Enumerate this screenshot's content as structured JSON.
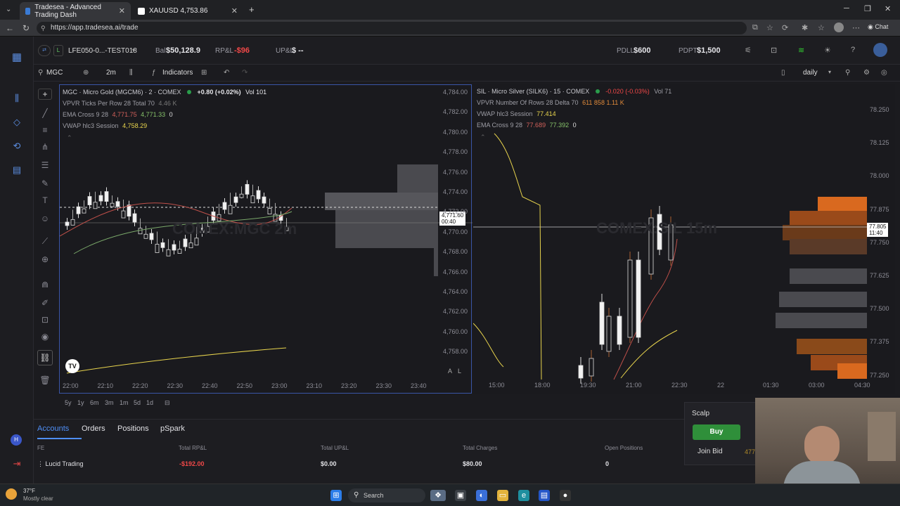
{
  "browser": {
    "tabs": [
      {
        "title": "Tradesea - Advanced Trading Dash",
        "active": true
      },
      {
        "title": "XAUUSD 4,753.86",
        "active": false
      }
    ],
    "url": "https://app.tradesea.ai/trade"
  },
  "header": {
    "account": "LFE050-0...-TEST018",
    "bal_label": "Bal",
    "bal_value": "$50,128.9",
    "rpl_label": "RP&L",
    "rpl_value": "-$96",
    "upl_label": "UP&L",
    "upl_value": "$ --",
    "pdll_label": "PDLL",
    "pdll_value": "$600",
    "pdpt_label": "PDPT",
    "pdpt_value": "$1,500"
  },
  "chartbar": {
    "symbol": "MGC",
    "interval": "2m",
    "indicators_label": "Indicators",
    "timeframe": "daily"
  },
  "left_chart": {
    "title": "MGC · Micro Gold (MGCM6) · 2 · COMEX",
    "change": "+0.80 (+0.02%)",
    "vol": "Vol 101",
    "ind1": "VPVR Ticks Per Row 28 Total 70",
    "ind1_val": "4.46 K",
    "ind2": "EMA Cross 9 28",
    "ind2_v1": "4,771.75",
    "ind2_v2": "4,771.33",
    "ind2_v3": "0",
    "ind3": "VWAP hlc3 Session",
    "ind3_val": "4,758.29",
    "watermark": "COMEX:MGC 2m",
    "yticks": [
      "4,784.00",
      "4,782.00",
      "4,780.00",
      "4,778.00",
      "4,776.00",
      "4,774.00",
      "4,772.00",
      "4,770.00",
      "4,768.00",
      "4,766.00",
      "4,764.00",
      "4,762.00",
      "4,760.00",
      "4,758.00"
    ],
    "xticks": [
      "22:00",
      "22:10",
      "22:20",
      "22:30",
      "22:40",
      "22:50",
      "23:00",
      "23:10",
      "23:20",
      "23:30",
      "23:40"
    ],
    "price_tag": "4,771.60",
    "price_tag_time": "00:40"
  },
  "right_chart": {
    "title": "SIL · Micro Silver (SILK6) · 15 · COMEX",
    "change": "-0.020 (-0.03%)",
    "vol": "Vol 71",
    "ind1": "VPVR Number Of Rows 28 Delta 70",
    "ind1_vals": "611  858  1.11 K",
    "ind2": "VWAP hlc3 Session",
    "ind2_val": "77.414",
    "ind3": "EMA Cross 9 28",
    "ind3_v1": "77.689",
    "ind3_v2": "77.392",
    "ind3_v3": "0",
    "watermark": "COMEX:SIL 15m",
    "yticks": [
      "78.250",
      "78.125",
      "78.000",
      "77.875",
      "77.750",
      "77.625",
      "77.500",
      "77.375",
      "77.250"
    ],
    "xticks": [
      "15:00",
      "18:00",
      "19:30",
      "21:00",
      "22:30",
      "22",
      "01:30",
      "03:00",
      "04:30",
      "06:00"
    ],
    "price_tag": "77.805",
    "price_tag_time": "11:40"
  },
  "rangebar": [
    "5y",
    "1y",
    "6m",
    "3m",
    "1m",
    "5d",
    "1d"
  ],
  "bottom": {
    "tabs": [
      "Accounts",
      "Orders",
      "Positions",
      "pSpark"
    ],
    "headers": [
      "FE",
      "Total RP&L",
      "Total UP&L",
      "Total Charges",
      "Open Positions"
    ],
    "row": {
      "name": "Lucid Trading",
      "rpl": "-$192.00",
      "upl": "$0.00",
      "charges": "$80.00",
      "open": "0"
    }
  },
  "orderbox": {
    "mode": "Scalp",
    "buy": "Buy",
    "join_bid": "Join Bid",
    "bid_price": "4771.5"
  },
  "taskbar": {
    "temp": "37°F",
    "weather": "Mostly clear",
    "search": "Search"
  },
  "colors": {
    "accent": "#4f8ff7",
    "buy": "#2f8f3a",
    "loss": "#f04848",
    "gold_val": "#e8d44d"
  }
}
